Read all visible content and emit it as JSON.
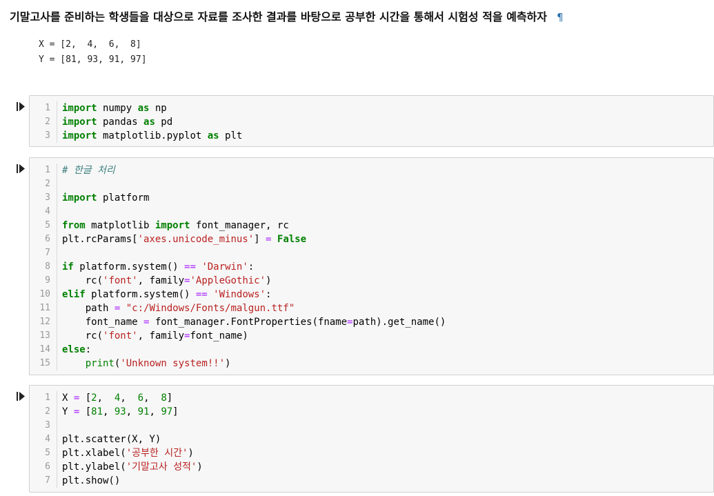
{
  "markdown": {
    "heading": "기말고사를 준비하는 학생들을 대상으로 자료를 조사한 결과를 바탕으로 공부한 시간을 통해서 시험성 적을 예측하자",
    "anchor": "¶",
    "pre_lines": [
      "X = [2,  4,  6,  8]",
      "Y = [81, 93, 91, 97]"
    ]
  },
  "cells": [
    {
      "run_label": "run-cell",
      "line_numbers": [
        "1",
        "2",
        "3"
      ],
      "code": [
        "import numpy as np",
        "import pandas as pd",
        "import matplotlib.pyplot as plt"
      ]
    },
    {
      "run_label": "run-cell",
      "line_numbers": [
        "1",
        "2",
        "3",
        "4",
        "5",
        "6",
        "7",
        "8",
        "9",
        "10",
        "11",
        "12",
        "13",
        "14",
        "15"
      ],
      "code": [
        "# 한글 처리",
        "",
        "import platform",
        "",
        "from matplotlib import font_manager, rc",
        "plt.rcParams['axes.unicode_minus'] = False",
        "",
        "if platform.system() == 'Darwin':",
        "    rc('font', family='AppleGothic')",
        "elif platform.system() == 'Windows':",
        "    path = \"c:/Windows/Fonts/malgun.ttf\"",
        "    font_name = font_manager.FontProperties(fname=path).get_name()",
        "    rc('font', family=font_name)",
        "else:",
        "    print('Unknown system!!')"
      ]
    },
    {
      "run_label": "run-cell",
      "line_numbers": [
        "1",
        "2",
        "3",
        "4",
        "5",
        "6",
        "7"
      ],
      "code": [
        "X = [2,  4,  6,  8]",
        "Y = [81, 93, 91, 97]",
        "",
        "plt.scatter(X, Y)",
        "plt.xlabel('공부한 시간')",
        "plt.ylabel('기말고사 성적')",
        "plt.show()"
      ]
    }
  ],
  "colors": {
    "keyword": "#008000",
    "string": "#ba2121",
    "comment": "#408080",
    "operator": "#aa22ff",
    "cell_bg": "#f7f7f7",
    "cell_border": "#cfcfcf",
    "anchor": "#296eaa"
  },
  "icons": {
    "run": "play-step-icon"
  }
}
